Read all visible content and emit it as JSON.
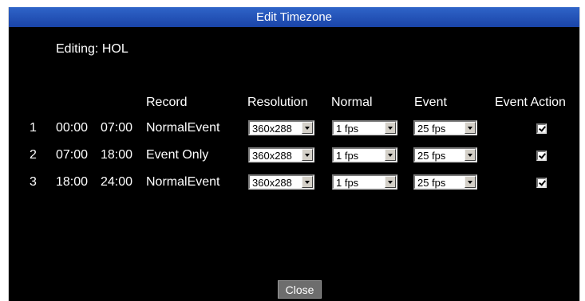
{
  "dialog": {
    "title": "Edit Timezone",
    "editing_label": "Editing: HOL",
    "close_label": "Close"
  },
  "table": {
    "headers": {
      "record": "Record",
      "resolution": "Resolution",
      "normal": "Normal",
      "event": "Event",
      "event_action": "Event Action"
    },
    "rows": [
      {
        "index": "1",
        "start": "00:00",
        "end": "07:00",
        "record": "NormalEvent",
        "resolution": "360x288",
        "normal": "1 fps",
        "event": "25 fps",
        "event_action": true
      },
      {
        "index": "2",
        "start": "07:00",
        "end": "18:00",
        "record": "Event Only",
        "resolution": "360x288",
        "normal": "1 fps",
        "event": "25 fps",
        "event_action": true
      },
      {
        "index": "3",
        "start": "18:00",
        "end": "24:00",
        "record": "NormalEvent",
        "resolution": "360x288",
        "normal": "1 fps",
        "event": "25 fps",
        "event_action": true
      }
    ]
  }
}
